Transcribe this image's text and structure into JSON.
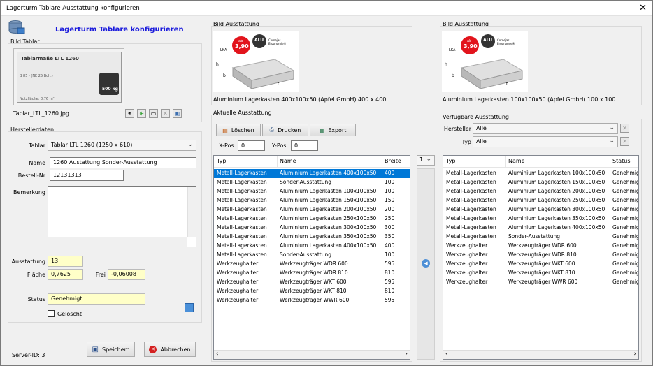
{
  "window": {
    "title": "Lagerturm Tablare Ausstattung konfigurieren",
    "close": "✕"
  },
  "header": {
    "title": "Lagerturm Tablare  konfigurieren"
  },
  "bild_tablar": {
    "legend": "Bild Tablar",
    "filename": "Tablar_LTL_1260.jpg",
    "img_title": "Tablarmaße LTL 1260",
    "img_weight": "500 kg",
    "img_area": "Nutzfläche: 0,76 m²",
    "img_label_b": "B 85 - (NE 25 Bch.)"
  },
  "hersteller": {
    "legend": "Herstellerdaten",
    "tablar_label": "Tablar",
    "tablar_value": "Tablar LTL 1260 (1250 x 610)",
    "name_label": "Name",
    "name_value": "1260 Austattung Sonder-Ausstattung",
    "bestell_label": "Bestell-Nr",
    "bestell_value": "12131313",
    "bemerkung_label": "Bemerkung",
    "ausstattung_label": "Ausstattung",
    "ausstattung_value": "13",
    "flaeche_label": "Fläche",
    "flaeche_value": "0,7625",
    "frei_label": "Frei",
    "frei_value": "-0,06008",
    "status_label": "Status",
    "status_value": "Genehmigt",
    "geloescht_label": "Gelöscht",
    "geloescht_checked": false
  },
  "footer": {
    "server_id": "Server-ID:  3",
    "save": "Speichem",
    "cancel": "Abbrechen"
  },
  "bild_aktuell": {
    "legend": "Bild Ausstattung",
    "caption": "Aluminium Lagerkasten 400x100x50 (Apfel GmbH) 400 x 400",
    "badge_ab": "ab",
    "badge_price": "3,90",
    "badge_alu": "ALU",
    "badge_text": "Cornejas Ergonomie®",
    "lka": "LKA",
    "h": "h",
    "b": "b",
    "t": "t"
  },
  "bild_verfuegbar": {
    "legend": "Bild Ausstattung",
    "caption": "Aluminium Lagerkasten 100x100x50 (Apfel GmbH) 100 x 100",
    "badge_ab": "ab",
    "badge_price": "3,90",
    "badge_alu": "ALU",
    "badge_text": "Cornejas Ergonomie®",
    "lka": "LKA",
    "h": "h",
    "b": "b",
    "t": "t"
  },
  "aktuell": {
    "legend": "Aktuelle Ausstattung",
    "delete": "Löschen",
    "print": "Drucken",
    "export": "Export",
    "xpos_label": "X-Pos",
    "xpos_value": "0",
    "ypos_label": "Y-Pos",
    "ypos_value": "0",
    "columns": [
      "Typ",
      "Name",
      "Breite"
    ],
    "rows": [
      [
        "Metall-Lagerkasten",
        "Aluminium Lagerkasten 400x100x50",
        "400"
      ],
      [
        "Metall-Lagerkasten",
        "Sonder-Ausstattung",
        "100"
      ],
      [
        "Metall-Lagerkasten",
        "Aluminium Lagerkasten 100x100x50",
        "100"
      ],
      [
        "Metall-Lagerkasten",
        "Aluminium Lagerkasten 150x100x50",
        "150"
      ],
      [
        "Metall-Lagerkasten",
        "Aluminium Lagerkasten 200x100x50",
        "200"
      ],
      [
        "Metall-Lagerkasten",
        "Aluminium Lagerkasten 250x100x50",
        "250"
      ],
      [
        "Metall-Lagerkasten",
        "Aluminium Lagerkasten 300x100x50",
        "300"
      ],
      [
        "Metall-Lagerkasten",
        "Aluminium Lagerkasten 350x100x50",
        "350"
      ],
      [
        "Metall-Lagerkasten",
        "Aluminium Lagerkasten 400x100x50",
        "400"
      ],
      [
        "Metall-Lagerkasten",
        "Sonder-Ausstattung",
        "100"
      ],
      [
        "Werkzeughalter",
        "Werkzeugträger WDR 600",
        "595"
      ],
      [
        "Werkzeughalter",
        "Werkzeugträger WDR 810",
        "810"
      ],
      [
        "Werkzeughalter",
        "Werkzeugträger WKT 600",
        "595"
      ],
      [
        "Werkzeughalter",
        "Werkzeugträger WKT 810",
        "810"
      ],
      [
        "Werkzeughalter",
        "Werkzeugträger WWR 600",
        "595"
      ]
    ]
  },
  "middle": {
    "count": "1"
  },
  "verfuegbar": {
    "legend": "Verfügbare Ausstattung",
    "hersteller_label": "Hersteller",
    "hersteller_value": "Alle",
    "typ_label": "Typ",
    "typ_value": "Alle",
    "columns": [
      "Typ",
      "Name",
      "Status"
    ],
    "rows": [
      [
        "Metall-Lagerkasten",
        "Aluminium Lagerkasten 100x100x50",
        "Genehmigt"
      ],
      [
        "Metall-Lagerkasten",
        "Aluminium Lagerkasten 150x100x50",
        "Genehmigt"
      ],
      [
        "Metall-Lagerkasten",
        "Aluminium Lagerkasten 200x100x50",
        "Genehmigt"
      ],
      [
        "Metall-Lagerkasten",
        "Aluminium Lagerkasten 250x100x50",
        "Genehmigt"
      ],
      [
        "Metall-Lagerkasten",
        "Aluminium Lagerkasten 300x100x50",
        "Genehmigt"
      ],
      [
        "Metall-Lagerkasten",
        "Aluminium Lagerkasten 350x100x50",
        "Genehmigt"
      ],
      [
        "Metall-Lagerkasten",
        "Aluminium Lagerkasten 400x100x50",
        "Genehmigt"
      ],
      [
        "Metall-Lagerkasten",
        "Sonder-Ausstattung",
        "Genehmigt"
      ],
      [
        "Werkzeughalter",
        "Werkzeugträger WDR 600",
        "Genehmigt"
      ],
      [
        "Werkzeughalter",
        "Werkzeugträger WDR 810",
        "Genehmigt"
      ],
      [
        "Werkzeughalter",
        "Werkzeugträger WKT 600",
        "Genehmigt"
      ],
      [
        "Werkzeughalter",
        "Werkzeugträger WKT 810",
        "Genehmigt"
      ],
      [
        "Werkzeughalter",
        "Werkzeugträger WWR 600",
        "Genehmigt"
      ]
    ]
  },
  "colors": {
    "title_blue": "#1a1adc",
    "selection": "#0078d7",
    "readonly_yellow": "#ffffc8",
    "badge_red": "#e2141c"
  }
}
